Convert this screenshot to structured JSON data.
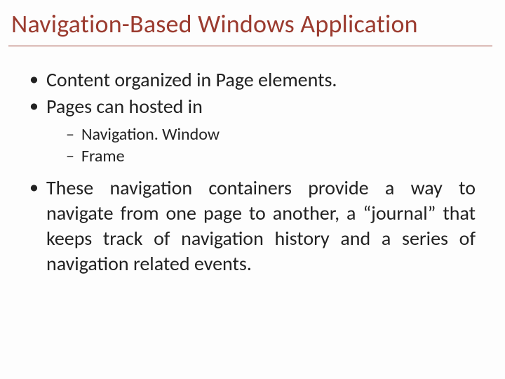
{
  "title": "Navigation-Based Windows Application",
  "bullets": {
    "b1": "Content organized in Page elements.",
    "b2": "Pages can hosted in",
    "sub1": "Navigation. Window",
    "sub2": "Frame",
    "b3": "These navigation containers provide a way to navigate from one page to another, a “journal” that keeps track of navigation history and a series of navigation related events."
  }
}
